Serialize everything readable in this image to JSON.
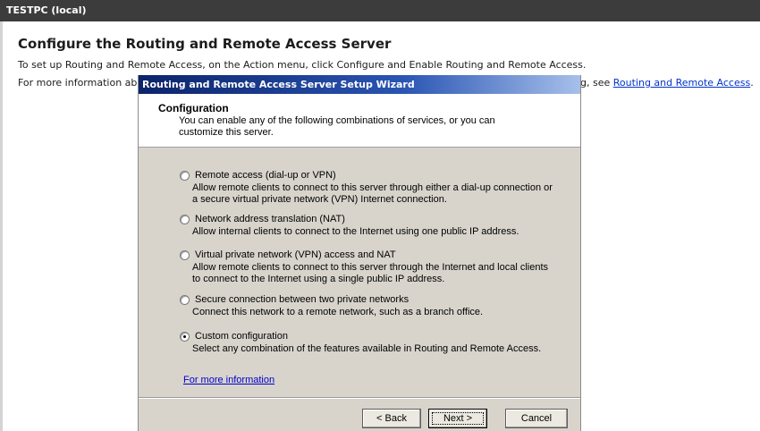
{
  "console": {
    "title": "TESTPC (local)",
    "heading": "Configure the Routing and Remote Access Server",
    "line1": "To set up Routing and Remote Access, on the Action menu, click Configure and Enable Routing and Remote Access.",
    "line2_start": "For more information ab",
    "line2_end": "g, see",
    "line2_link": "Routing and Remote Access",
    "line2_period": "."
  },
  "wizard": {
    "title": "Routing and Remote Access Server Setup Wizard",
    "header": {
      "title": "Configuration",
      "description": "You can enable any of the following combinations of services, or you can customize this server."
    },
    "options": [
      {
        "label": "Remote access (dial-up or VPN)",
        "description": "Allow remote clients to connect to this server through either a dial-up connection or a secure virtual private network (VPN) Internet connection.",
        "selected": false
      },
      {
        "label": "Network address translation (NAT)",
        "description": "Allow internal clients to connect to the Internet using one public IP address.",
        "selected": false
      },
      {
        "label": "Virtual private network (VPN) access and NAT",
        "description": "Allow remote clients to connect to this server through the Internet and local clients to connect to the Internet using a single public IP address.",
        "selected": false
      },
      {
        "label": "Secure connection between two private networks",
        "description": "Connect this network to a remote network, such as a branch office.",
        "selected": false
      },
      {
        "label": "Custom configuration",
        "description": "Select any combination of the features available in Routing and Remote Access.",
        "selected": true
      }
    ],
    "more_info": "For more information",
    "buttons": {
      "back": "< Back",
      "next": "Next >",
      "cancel": "Cancel"
    }
  }
}
